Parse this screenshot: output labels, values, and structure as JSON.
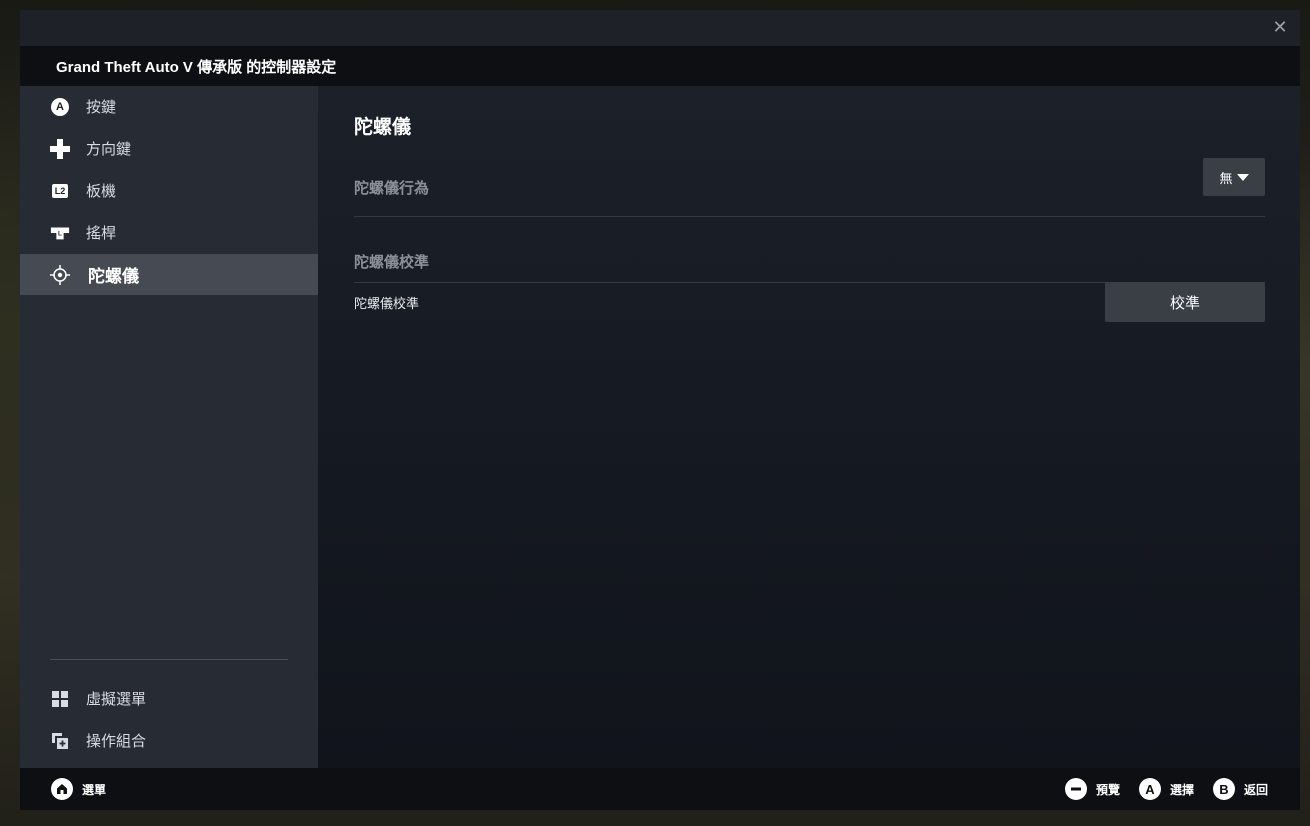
{
  "window": {
    "title": "Grand Theft Auto V 傳承版 的控制器設定"
  },
  "sidebar": {
    "items": [
      {
        "label": "按鍵",
        "icon": "a-button-icon",
        "glyph": "A"
      },
      {
        "label": "方向鍵",
        "icon": "dpad-icon"
      },
      {
        "label": "板機",
        "icon": "l2-trigger-icon",
        "glyph": "L2"
      },
      {
        "label": "搖桿",
        "icon": "left-stick-icon",
        "glyph": "L"
      },
      {
        "label": "陀螺儀",
        "icon": "gyro-icon",
        "active": true
      }
    ],
    "bottom_items": [
      {
        "label": "虛擬選單",
        "icon": "grid-icon"
      },
      {
        "label": "操作組合",
        "icon": "add-layer-icon"
      }
    ]
  },
  "main": {
    "section_title": "陀螺儀",
    "gyro_behavior": {
      "label": "陀螺儀行為",
      "value": "無"
    },
    "calibration_header": "陀螺儀校準",
    "calibration": {
      "label": "陀螺儀校準",
      "button": "校準"
    }
  },
  "footer": {
    "menu": {
      "label": "選單",
      "icon": "home-button-icon"
    },
    "preview": {
      "label": "預覽",
      "icon": "minus-button-icon"
    },
    "select": {
      "label": "選擇",
      "glyph": "A"
    },
    "back": {
      "label": "返回",
      "glyph": "B"
    }
  },
  "close_glyph": "✕"
}
